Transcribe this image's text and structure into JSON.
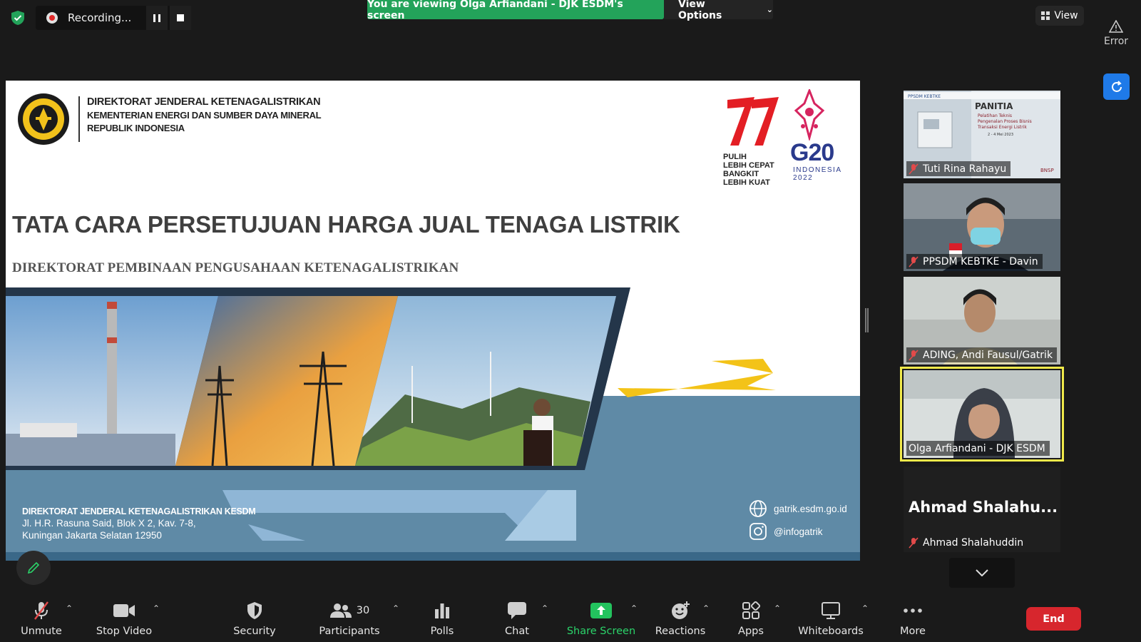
{
  "recording": {
    "label": "Recording..."
  },
  "banner": {
    "viewing_text": "You are viewing Olga Arfiandani - DJK ESDM's screen",
    "view_options": "View Options"
  },
  "view_button": {
    "label": "View"
  },
  "status": {
    "error_label": "Error"
  },
  "slide": {
    "org_line1": "DIREKTORAT JENDERAL KETENAGALISTRIKAN",
    "org_line2": "KEMENTERIAN ENERGI DAN SUMBER DAYA MINERAL",
    "org_line3": "REPUBLIK INDONESIA",
    "logo77_text": [
      "PULIH",
      "LEBIH CEPAT",
      "BANGKIT",
      "LEBIH KUAT"
    ],
    "g20_text": "G20",
    "g20_sub": [
      "INDONESIA",
      "2022"
    ],
    "title": "TATA CARA PERSETUJUAN HARGA JUAL TENAGA LISTRIK",
    "subtitle": "DIREKTORAT PEMBINAAN PENGUSAHAAN KETENAGALISTRIKAN",
    "address_line1": "DIREKTORAT JENDERAL KETENAGALISTRIKAN KESDM",
    "address_line2": "Jl. H.R. Rasuna Said, Blok X 2, Kav. 7-8,",
    "address_line3": "Kuningan Jakarta Selatan 12950",
    "website": "gatrik.esdm.go.id",
    "instagram": "@infogatrik"
  },
  "participants": [
    {
      "name": "Tuti Rina Rahayu",
      "thumb_title": "PANITIA",
      "thumb_sub": [
        "Pelatihan Teknis",
        "Pengenalan Proses Bisnis",
        "Transaksi Energi Listrik"
      ],
      "thumb_date": "2 - 4 Mei 2023",
      "thumb_brand": "BNSP",
      "thumb_header": "PPSDM KEBTKE"
    },
    {
      "name": "PPSDM KEBTKE - Davin"
    },
    {
      "name": "ADING, Andi Fausul/Gatrik"
    },
    {
      "name": "Olga Arfiandani - DJK ESDM",
      "active": true
    },
    {
      "name": "Ahmad Shalahuddin",
      "display": "Ahmad  Shalahu..."
    }
  ],
  "toolbar": {
    "unmute": "Unmute",
    "stop_video": "Stop Video",
    "security": "Security",
    "participants": "Participants",
    "participants_count": "30",
    "polls": "Polls",
    "chat": "Chat",
    "share_screen": "Share Screen",
    "reactions": "Reactions",
    "apps": "Apps",
    "whiteboards": "Whiteboards",
    "more": "More",
    "end": "End"
  },
  "colors": {
    "share_green": "#23a35a",
    "end_red": "#d7262d",
    "active_speaker": "#f0e94a",
    "accent_blue": "#1f7ae8"
  }
}
